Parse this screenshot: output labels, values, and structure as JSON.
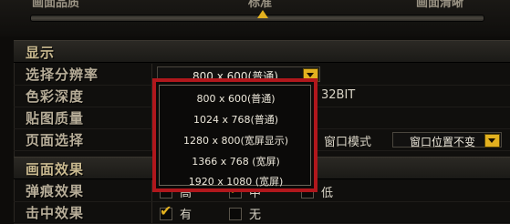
{
  "top": {
    "cut_labels": [
      "画面品质",
      "标准",
      "画面清晰"
    ]
  },
  "sections": {
    "display": "显示",
    "effects": "画面效果"
  },
  "rows": {
    "resolution": "选择分辨率",
    "color_depth": "色彩深度",
    "texture_quality": "贴图质量",
    "page_select": "页面选择",
    "bullet_effect": "弹痕效果",
    "hit_effect": "击中效果"
  },
  "resolution_combo": {
    "value": "800 x 600(普通)"
  },
  "color_depth_value": "32BIT",
  "window_mode": {
    "label": "窗口模式",
    "value": "窗口位置不变"
  },
  "dropdown_options": [
    "800 x 600(普通)",
    "1024 x 768(普通)",
    "1280 x 800(宽屏显示)",
    "1366 x 768 (宽屏)",
    "1920 x 1080 (宽屏)"
  ],
  "bullet_options": {
    "high": "高",
    "medium": "中",
    "low": "低"
  },
  "hit_options": {
    "yes": "有",
    "no": "无"
  },
  "colors": {
    "accent": "#e3b11f",
    "highlight_border": "#b0171c"
  }
}
